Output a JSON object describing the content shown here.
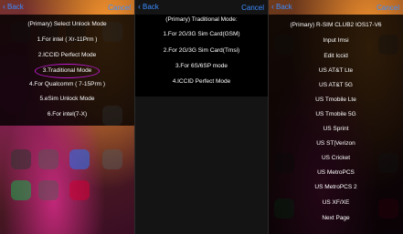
{
  "panels": [
    {
      "back_label": "Back",
      "cancel_label": "Cancel",
      "title": "(Primary) Select Unlock Mode",
      "items": [
        "1.For intel ( Xr-11Prm )",
        "2.ICCID Perfect Mode",
        "3.Traditional Mode",
        "4.For Qualcomm ( 7-15Prm )",
        "5.eSim Unlock Mode",
        "6.For intel(7-X)"
      ],
      "selected_index": 2
    },
    {
      "back_label": "Back",
      "cancel_label": "Cancel",
      "title": "(Primary) Traditional Mode:",
      "items": [
        "1.For 2G/3G Sim Card(GSM)",
        "2.For 2G/3G Sim Card(Tmsi)",
        "3.For 6S/6SP mode",
        "4.ICCID Perfect Mode"
      ]
    },
    {
      "back_label": "Back",
      "cancel_label": "Cancel",
      "title": "(Primary) R-SIM CLUB2 IOS17-V6",
      "items": [
        "Input Imsi",
        "Edit Iccid",
        "US AT&T Lte",
        "US AT&T 5G",
        "US Tmobile Lte",
        "US Tmobile 5G",
        "US Sprint",
        "US ST|Verizon",
        "US Cricket",
        "US MetroPCS",
        "US MetroPCS 2",
        "US XF/XE",
        "Next Page"
      ]
    }
  ],
  "colors": {
    "accent": "#3b8cff",
    "selection_ring": "#c11ad1"
  },
  "icons": {
    "back": "chevron-left-icon"
  }
}
